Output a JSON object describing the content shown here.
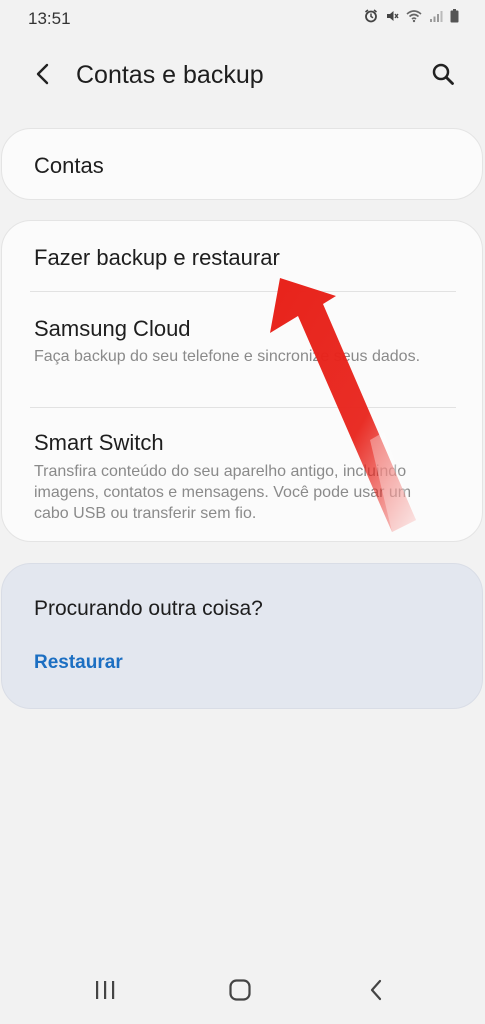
{
  "status_bar": {
    "time": "13:51",
    "icons": [
      "alarm-icon",
      "mute-icon",
      "wifi-icon",
      "signal-icon",
      "battery-icon"
    ]
  },
  "app_bar": {
    "title": "Contas e backup",
    "back_icon": "back-arrow-icon",
    "search_icon": "search-icon"
  },
  "cards": {
    "accounts": {
      "title": "Contas"
    },
    "backup": {
      "items": [
        {
          "title": "Fazer backup e restaurar",
          "subtitle": ""
        },
        {
          "title": "Samsung Cloud",
          "subtitle": "Faça backup do seu telefone e sincronize seus dados."
        },
        {
          "title": "Smart Switch",
          "subtitle": "Transfira conteúdo do seu aparelho antigo, incluindo imagens, contatos e mensagens. Você pode usar um cabo USB ou transferir sem fio."
        }
      ]
    }
  },
  "help": {
    "title": "Procurando outra coisa?",
    "link": "Restaurar"
  },
  "nav_bar": {
    "icons": [
      "recent-apps-icon",
      "home-icon",
      "nav-back-icon"
    ]
  },
  "colors": {
    "background": "#f2f2f2",
    "card": "#fbfbfb",
    "help_card": "#e3e7ef",
    "link": "#1c6fc2",
    "annotation_arrow": "#e8231b"
  }
}
